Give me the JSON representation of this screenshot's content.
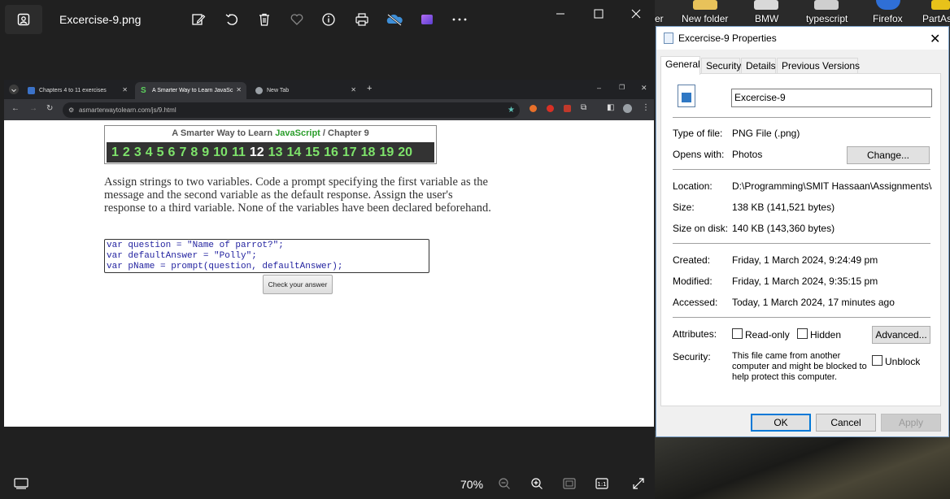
{
  "photos": {
    "file_title": "Excercise-9.png",
    "zoom": "70%",
    "toolbar_icons": [
      "edit-icon",
      "rotate-icon",
      "delete-icon",
      "favorite-icon",
      "info-icon",
      "print-icon",
      "onedrive-icon",
      "clipchamp-icon",
      "more-icon"
    ]
  },
  "chrome": {
    "tabs": [
      {
        "label": "Chapters 4 to 11 exercises"
      },
      {
        "label": "A Smarter Way to Learn JavaSc"
      },
      {
        "label": "New Tab"
      }
    ],
    "new_tab_symbol": "+",
    "url": "asmarterwaytolearn.com/js/9.html"
  },
  "page": {
    "book_title_prefix": "A Smarter Way to Learn ",
    "book_title_js": "JavaScript",
    "book_title_suffix": "  /  Chapter 9",
    "chapters": [
      "1",
      "2",
      "3",
      "4",
      "5",
      "6",
      "7",
      "8",
      "9",
      "10",
      "11",
      "12",
      "13",
      "14",
      "15",
      "16",
      "17",
      "18",
      "19",
      "20"
    ],
    "current_chapter": "12",
    "instructions": "Assign strings to two variables. Code a prompt specifying the first variable as the message and the second variable as the default response. Assign the user's response to a third variable. None of the variables have been declared beforehand.",
    "code": "var question = \"Name of parrot?\";\nvar defaultAnswer = \"Polly\";\nvar pName = prompt(question, defaultAnswer);",
    "check_button": "Check your answer"
  },
  "desktop": {
    "icons": [
      "er",
      "New folder",
      "BMW",
      "typescript",
      "Firefox",
      "PartAs"
    ]
  },
  "properties": {
    "title": "Excercise-9 Properties",
    "tabs": [
      "General",
      "Security",
      "Details",
      "Previous Versions"
    ],
    "file_name": "Excercise-9",
    "type_label": "Type of file:",
    "type_value": "PNG File (.png)",
    "opens_label": "Opens with:",
    "opens_value": "Photos",
    "change_button": "Change...",
    "location_label": "Location:",
    "location_value": "D:\\Programming\\SMIT Hassaan\\Assignments\\Js Ex",
    "size_label": "Size:",
    "size_value": "138 KB (141,521 bytes)",
    "size_disk_label": "Size on disk:",
    "size_disk_value": "140 KB (143,360 bytes)",
    "created_label": "Created:",
    "created_value": "Friday, 1 March 2024, 9:24:49 pm",
    "modified_label": "Modified:",
    "modified_value": "Friday, 1 March 2024, 9:35:15 pm",
    "accessed_label": "Accessed:",
    "accessed_value": "Today, 1 March 2024, 17 minutes ago",
    "attributes_label": "Attributes:",
    "readonly_label": "Read-only",
    "hidden_label": "Hidden",
    "advanced_button": "Advanced...",
    "security_label": "Security:",
    "security_text": "This file came from another computer and might be blocked to help protect this computer.",
    "unblock_label": "Unblock",
    "ok_button": "OK",
    "cancel_button": "Cancel",
    "apply_button": "Apply"
  }
}
